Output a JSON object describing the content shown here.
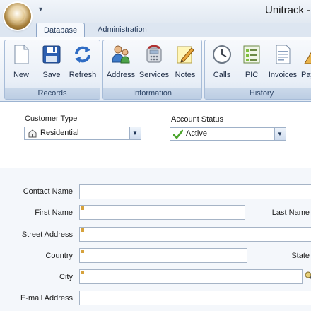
{
  "app": {
    "title": "Unitrack -"
  },
  "ribbon": {
    "tabs": [
      {
        "label": "Database"
      },
      {
        "label": "Administration"
      }
    ],
    "groups": {
      "records": {
        "label": "Records",
        "buttons": [
          {
            "label": "New",
            "icon": "new-document-icon"
          },
          {
            "label": "Save",
            "icon": "save-floppy-icon"
          },
          {
            "label": "Refresh",
            "icon": "refresh-icon"
          }
        ]
      },
      "information": {
        "label": "Information",
        "buttons": [
          {
            "label": "Address",
            "icon": "address-people-icon"
          },
          {
            "label": "Services",
            "icon": "services-phone-icon"
          },
          {
            "label": "Notes",
            "icon": "notes-pencil-icon"
          }
        ]
      },
      "history": {
        "label": "History",
        "buttons": [
          {
            "label": "Calls",
            "icon": "clock-icon"
          },
          {
            "label": "PIC",
            "icon": "pic-list-icon"
          },
          {
            "label": "Invoices",
            "icon": "invoice-document-icon"
          },
          {
            "label": "Pay",
            "icon": "payments-icon"
          }
        ]
      }
    }
  },
  "form": {
    "customer_type": {
      "label": "Customer Type",
      "value": "Residential"
    },
    "account_status": {
      "label": "Account Status",
      "value": "Active"
    },
    "fields": {
      "contact_name": {
        "label": "Contact Name",
        "value": ""
      },
      "first_name": {
        "label": "First Name",
        "value": ""
      },
      "last_name": {
        "label": "Last Name",
        "value": ""
      },
      "street_address": {
        "label": "Street Address",
        "value": ""
      },
      "country": {
        "label": "Country",
        "value": ""
      },
      "state": {
        "label": "State",
        "value": ""
      },
      "city": {
        "label": "City",
        "value": ""
      },
      "email": {
        "label": "E-mail Address",
        "value": ""
      }
    }
  },
  "colors": {
    "ribbon_border": "#a7bcd8",
    "group_label_bg": "#bccde3",
    "field_border": "#a6b4c6",
    "active_check": "#4aa42a"
  }
}
